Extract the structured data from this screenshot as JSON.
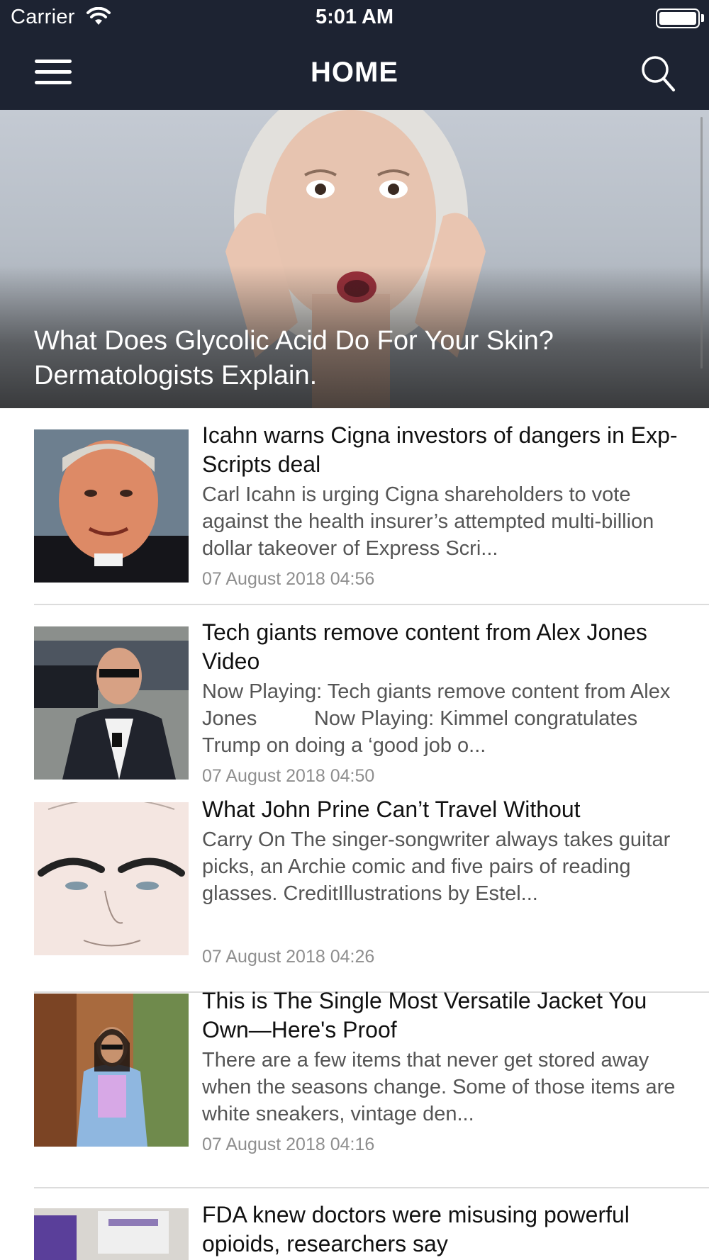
{
  "status_bar": {
    "carrier": "Carrier",
    "time": "5:01 AM"
  },
  "nav": {
    "title": "HOME",
    "menu_icon": "hamburger-menu-icon",
    "search_icon": "search-icon"
  },
  "hero": {
    "title": "What Does Glycolic Acid Do For Your Skin? Dermatologists Explain."
  },
  "articles": [
    {
      "title": "Icahn warns Cigna investors of dangers in Exp-Scripts deal",
      "summary": "Carl Icahn is urging Cigna shareholders to vote against the health insurer’s attempted multi-billion dollar takeover of Express Scri...",
      "date": "07 August 2018 04:56"
    },
    {
      "title": "Tech giants remove content from Alex Jones Video",
      "summary": "Now Playing: Tech giants remove content from Alex Jones          Now Playing: Kimmel congratulates Trump on doing a ‘good job o...",
      "date": "07 August 2018 04:50"
    },
    {
      "title": "What John Prine Can’t Travel Without",
      "summary": "Carry On  The singer-songwriter always takes guitar picks, an Archie comic and five pairs of reading glasses.  CreditIllustrations by Estel...",
      "date": "07 August 2018 04:26"
    },
    {
      "title": "This is The Single Most Versatile Jacket You Own—Here's Proof",
      "summary": "There are a few items that never get stored away when the seasons change. Some of those items are white sneakers, vintage den...",
      "date": "07 August 2018 04:16"
    },
    {
      "title": "FDA knew doctors were misusing powerful opioids, researchers say",
      "summary": "",
      "date": ""
    }
  ]
}
